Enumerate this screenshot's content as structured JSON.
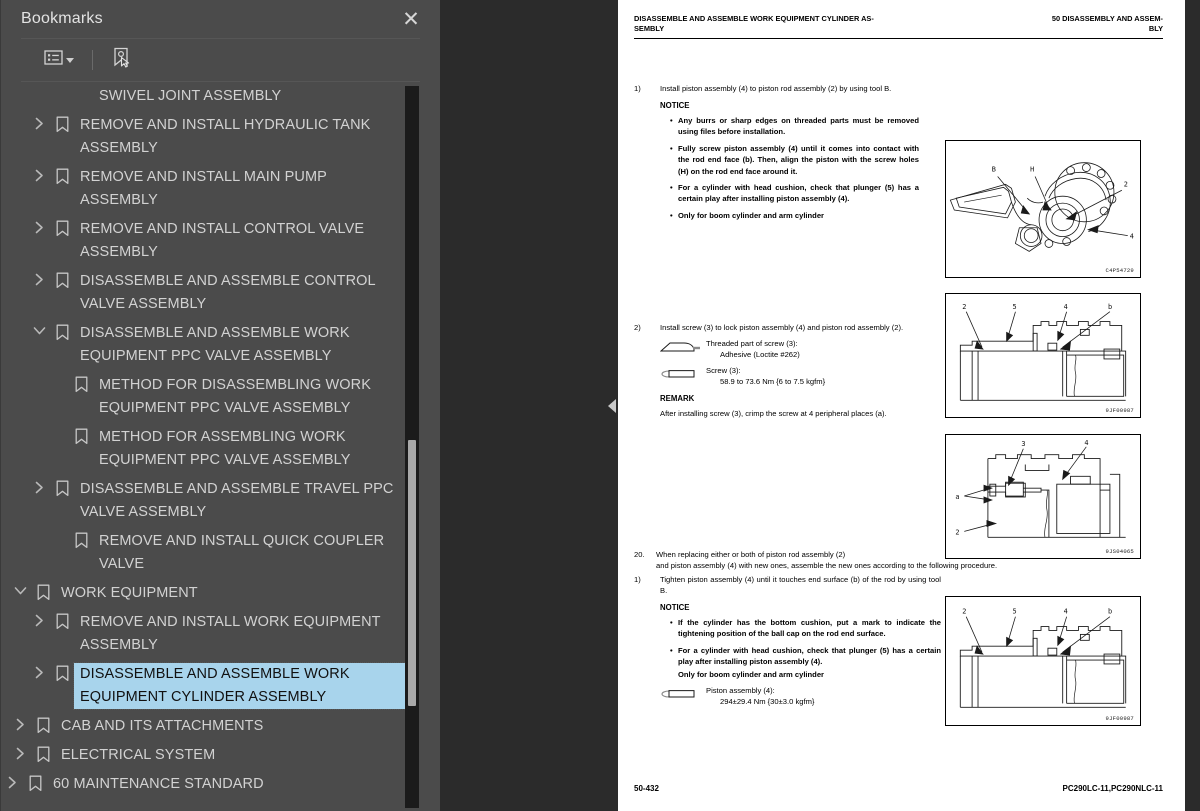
{
  "sidebar": {
    "title": "Bookmarks",
    "close_label": "✕",
    "toolbar": {
      "list_options_icon": "list-options-icon",
      "dropdown_caret": "chevron-down-icon",
      "new_bookmark_icon": "new-bookmark-icon"
    },
    "items": [
      {
        "label": "SWIVEL JOINT ASSEMBLY",
        "indent": 2,
        "chevron": "none",
        "selected": false
      },
      {
        "label": "REMOVE AND INSTALL HYDRAULIC TANK ASSEMBLY",
        "indent": 1,
        "chevron": "right",
        "selected": false
      },
      {
        "label": "REMOVE AND INSTALL MAIN PUMP ASSEMBLY",
        "indent": 1,
        "chevron": "right",
        "selected": false
      },
      {
        "label": "REMOVE AND INSTALL CONTROL VALVE ASSEMBLY",
        "indent": 1,
        "chevron": "right",
        "selected": false
      },
      {
        "label": "DISASSEMBLE AND ASSEMBLE CONTROL VALVE ASSEMBLY",
        "indent": 1,
        "chevron": "right",
        "selected": false
      },
      {
        "label": "DISASSEMBLE AND ASSEMBLE WORK EQUIPMENT PPC VALVE ASSEMBLY",
        "indent": 1,
        "chevron": "down",
        "selected": false
      },
      {
        "label": "METHOD FOR DISASSEMBLING WORK EQUIPMENT PPC VALVE ASSEMBLY",
        "indent": 2,
        "chevron": "none",
        "selected": false
      },
      {
        "label": "METHOD FOR ASSEMBLING WORK EQUIPMENT PPC VALVE ASSEMBLY",
        "indent": 2,
        "chevron": "none",
        "selected": false
      },
      {
        "label": "DISASSEMBLE AND ASSEMBLE TRAVEL PPC VALVE ASSEMBLY",
        "indent": 1,
        "chevron": "right",
        "selected": false
      },
      {
        "label": "REMOVE AND INSTALL QUICK COUPLER VALVE",
        "indent": 2,
        "chevron": "none",
        "selected": false
      },
      {
        "label": "WORK EQUIPMENT",
        "indent": 0,
        "chevron": "down",
        "selected": false
      },
      {
        "label": "REMOVE AND INSTALL WORK EQUIPMENT ASSEMBLY",
        "indent": 1,
        "chevron": "right",
        "selected": false
      },
      {
        "label": "DISASSEMBLE AND ASSEMBLE WORK EQUIPMENT CYLINDER ASSEMBLY",
        "indent": 1,
        "chevron": "right",
        "selected": true
      },
      {
        "label": "CAB AND ITS ATTACHMENTS",
        "indent": 0,
        "chevron": "right",
        "selected": false
      },
      {
        "label": "ELECTRICAL SYSTEM",
        "indent": 0,
        "chevron": "right",
        "selected": false
      },
      {
        "label": "60 MAINTENANCE STANDARD",
        "indent": -1,
        "chevron": "right",
        "selected": false
      }
    ]
  },
  "collapse_handle": {
    "icon": "collapse-left-icon"
  },
  "document": {
    "header": {
      "left": "DISASSEMBLE AND ASSEMBLE WORK EQUIPMENT CYLINDER AS-SEMBLY",
      "left_line1": "DISASSEMBLE AND ASSEMBLE WORK EQUIPMENT CYLINDER AS-",
      "left_line2": "SEMBLY",
      "right_line1": "50 DISASSEMBLY AND ASSEM-",
      "right_line2": "BLY"
    },
    "steps": {
      "s1_num": "1)",
      "s1_text": "Install piston assembly (4) to piston rod assembly (2) by using tool B.",
      "s1_notice": "NOTICE",
      "s1_bullets": [
        "Any burrs or sharp edges on threaded parts must be removed using files before installation.",
        "Fully screw piston assembly (4) until it comes into contact with the rod end face (b). Then, align the piston with the screw holes (H) on the rod end face around it.",
        "For a cylinder with head cushion, check that plunger (5) has a certain play after installing piston assembly (4).",
        "Only for boom cylinder and arm cylinder"
      ],
      "s2_num": "2)",
      "s2_text": "Install screw (3) to lock piston assembly (4) and piston rod assembly (2).",
      "s2_spec1_label": "Threaded part of screw (3):",
      "s2_spec1_value": "Adhesive (Loctite #262)",
      "s2_spec1_icon": "adhesive-symbol-icon",
      "s2_spec2_label": "Screw (3):",
      "s2_spec2_value": "58.9 to 73.6 Nm {6 to 7.5 kgfm}",
      "s2_spec2_icon": "torque-wrench-symbol-icon",
      "s2_remark_hd": "REMARK",
      "s2_remark_text": "After installing screw (3), crimp the screw at 4 peripheral places (a).",
      "s20_num": "20.",
      "s20_line1": "When replacing either or both of piston rod assembly (2)",
      "s20_line2": "and piston assembly (4) with new ones, assemble the new ones according to the following procedure.",
      "s20_1_num": "1)",
      "s20_1_text": "Tighten piston assembly (4) until it touches end surface (b) of the rod by using tool B.",
      "s20_notice": "NOTICE",
      "s20_bullets": [
        "If the cylinder has the bottom cushion, put a mark to indicate the tightening position of the ball cap on the rod end surface.",
        "For a cylinder with head cushion, check that plunger (5) has a certain play after installing piston assembly (4).",
        "Only for boom cylinder and arm cylinder"
      ],
      "s20_spec_label": "Piston assembly (4):",
      "s20_spec_value": "294±29.4 Nm {30±3.0 kgfm}",
      "s20_spec_icon": "torque-wrench-symbol-icon"
    },
    "figures": [
      {
        "code": "C4P54729",
        "name": "piston-rod-assembly-figure",
        "labels": [
          "B",
          "H",
          "2",
          "4"
        ]
      },
      {
        "code": "9JF00987",
        "name": "cylinder-cross-section-figure-1",
        "labels": [
          "2",
          "5",
          "4",
          "b"
        ]
      },
      {
        "code": "9JS04065",
        "name": "screw-lock-cross-section-figure",
        "labels": [
          "3",
          "4",
          "a",
          "2"
        ]
      },
      {
        "code": "9JF00987",
        "name": "cylinder-cross-section-figure-2",
        "labels": [
          "2",
          "5",
          "4",
          "b"
        ]
      }
    ],
    "footer": {
      "page_number": "50-432",
      "model": "PC290LC-11,PC290NLC-11"
    }
  },
  "colors": {
    "panel_bg": "#4b4b4b",
    "app_bg": "#2b2b2b",
    "selection": "#a8d4ec",
    "text": "#d2d2d2",
    "page_bg": "#ffffff"
  }
}
